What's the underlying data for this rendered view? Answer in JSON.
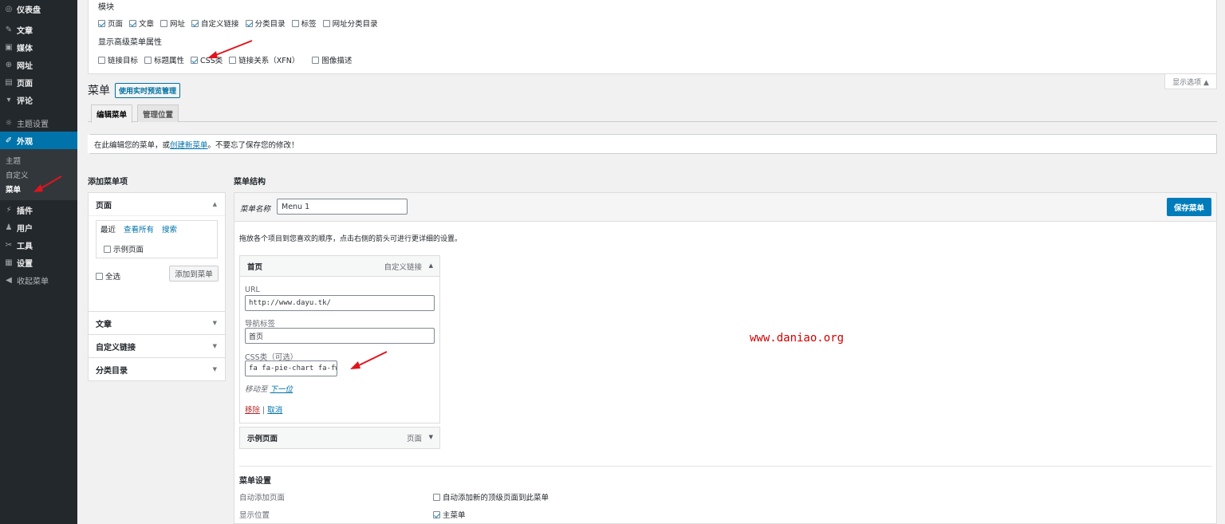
{
  "sidebar": {
    "items": [
      {
        "label": "仪表盘",
        "icon": "dashboard-icon",
        "glyph": "◎"
      },
      {
        "label": "文章",
        "icon": "pin-icon",
        "glyph": "✎"
      },
      {
        "label": "媒体",
        "icon": "media-icon",
        "glyph": "▣"
      },
      {
        "label": "网址",
        "icon": "globe-icon",
        "glyph": "⊕"
      },
      {
        "label": "页面",
        "icon": "page-icon",
        "glyph": "▤"
      },
      {
        "label": "评论",
        "icon": "comment-icon",
        "glyph": "▾"
      },
      {
        "label": "主题设置",
        "icon": "gear-icon",
        "glyph": "☼"
      },
      {
        "label": "外观",
        "icon": "brush-icon",
        "glyph": "✐"
      },
      {
        "label": "插件",
        "icon": "plugin-icon",
        "glyph": "⚡"
      },
      {
        "label": "用户",
        "icon": "user-icon",
        "glyph": "♟"
      },
      {
        "label": "工具",
        "icon": "wrench-icon",
        "glyph": "✂"
      },
      {
        "label": "设置",
        "icon": "settings-icon",
        "glyph": "▦"
      },
      {
        "label": "收起菜单",
        "icon": "collapse-icon",
        "glyph": "◀"
      }
    ],
    "sub_items": [
      "主题",
      "自定义",
      "菜单"
    ]
  },
  "screen_options": {
    "modules_title": "模块",
    "modules": [
      {
        "label": "页面",
        "checked": true
      },
      {
        "label": "文章",
        "checked": true
      },
      {
        "label": "网址",
        "checked": false
      },
      {
        "label": "自定义链接",
        "checked": true
      },
      {
        "label": "分类目录",
        "checked": true
      },
      {
        "label": "标签",
        "checked": false
      },
      {
        "label": "网址分类目录",
        "checked": false
      }
    ],
    "advanced_title": "显示高级菜单属性",
    "advanced": [
      {
        "label": "链接目标",
        "checked": false
      },
      {
        "label": "标题属性",
        "checked": false
      },
      {
        "label": "CSS类",
        "checked": true
      },
      {
        "label": "链接关系（XFN）",
        "checked": false
      },
      {
        "label": "图像描述",
        "checked": false
      }
    ],
    "toggle_label": "显示选项 ▲"
  },
  "heading": {
    "title": "菜单",
    "live_preview": "使用实时预览管理"
  },
  "tabs": {
    "edit": "编辑菜单",
    "locations": "管理位置"
  },
  "notice": {
    "before": "在此编辑您的菜单，或",
    "link": "创建新菜单",
    "after": "。不要忘了保存您的修改！"
  },
  "left": {
    "heading": "添加菜单项",
    "pages": {
      "title": "页面",
      "subtabs": [
        "最近",
        "查看所有",
        "搜索"
      ],
      "sample_page": "示例页面",
      "select_all": "全选",
      "add_button": "添加到菜单"
    },
    "sections": [
      "文章",
      "自定义链接",
      "分类目录"
    ]
  },
  "right": {
    "heading": "菜单结构",
    "menu_name_label": "菜单名称",
    "menu_name_value": "Menu 1",
    "save_button": "保存菜单",
    "instructions": "拖放各个项目到您喜欢的顺序，点击右侧的箭头可进行更详细的设置。",
    "item1": {
      "title": "首页",
      "type": "自定义链接",
      "url_label": "URL",
      "url_value": "http://www.dayu.tk/",
      "nav_label": "导航标签",
      "nav_value": "首页",
      "css_label": "CSS类（可选）",
      "css_value": "fa fa-pie-chart fa-fw",
      "move_label": "移动至",
      "move_link": "下一位",
      "remove": "移除",
      "separator": "|",
      "cancel": "取消"
    },
    "item2": {
      "title": "示例页面",
      "type": "页面"
    },
    "settings": {
      "title": "菜单设置",
      "auto_add_label": "自动添加页面",
      "auto_add_option": "自动添加新的顶级页面到此菜单",
      "auto_add_checked": false,
      "location_label": "显示位置",
      "location_option": "主菜单",
      "location_checked": true
    }
  },
  "watermark": "www.daniao.org",
  "colors": {
    "sidebar_bg": "#23282d",
    "accent": "#0073aa",
    "primary_button": "#007cba",
    "annotation_arrow": "#e0141e",
    "watermark": "#d10000"
  }
}
